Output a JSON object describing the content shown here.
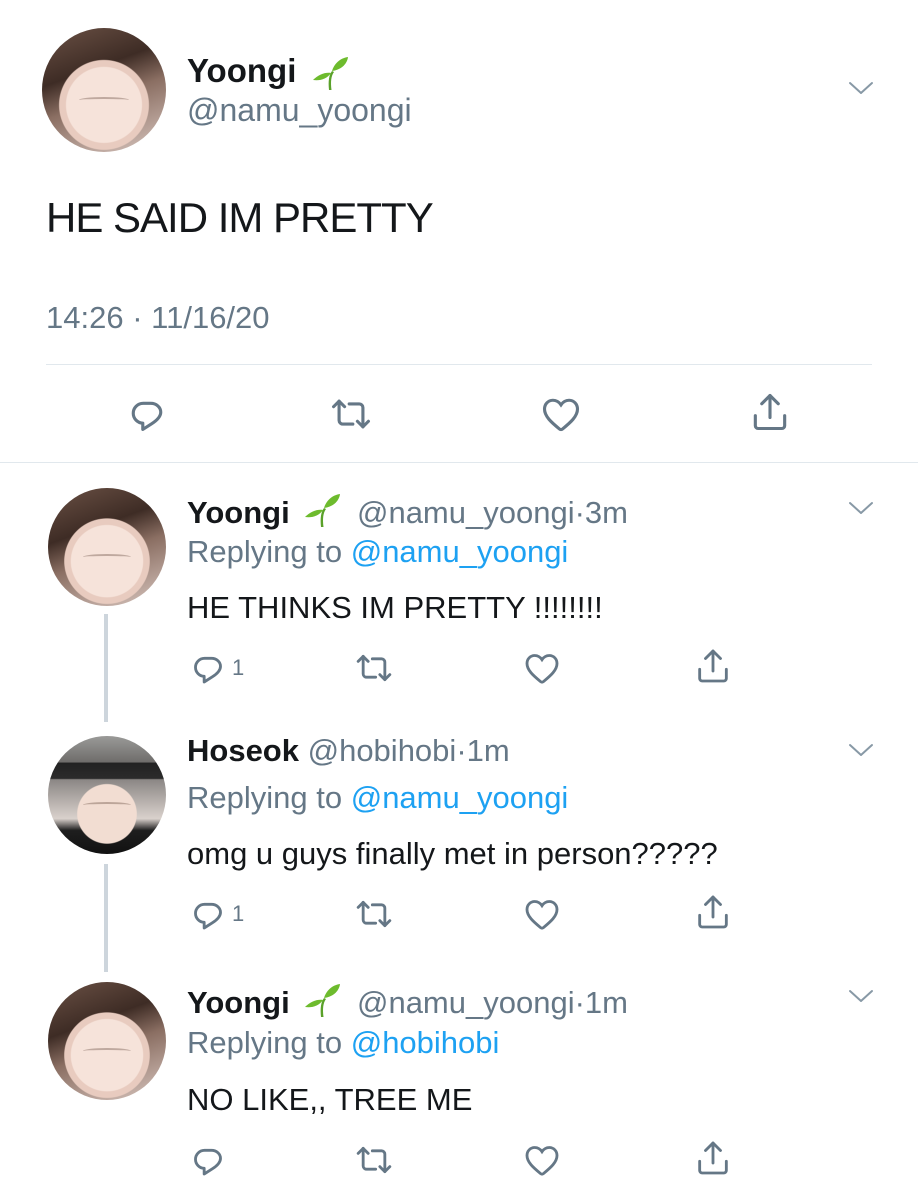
{
  "main_tweet": {
    "name": "Yoongi",
    "handle": "@namu_yoongi",
    "text": "HE SAID IM PRETTY",
    "time": "14:26",
    "date": "11/16/20"
  },
  "replies": [
    {
      "name": "Yoongi",
      "handle": "@namu_yoongi",
      "age": "3m",
      "replying_label": "Replying to",
      "replying_to": "@namu_yoongi",
      "text": "HE THINKS IM PRETTY !!!!!!!!",
      "reply_count": "1"
    },
    {
      "name": "Hoseok",
      "handle": "@hobihobi",
      "age": "1m",
      "replying_label": "Replying to",
      "replying_to": "@namu_yoongi",
      "text": "omg u guys finally met in person?????",
      "reply_count": "1"
    },
    {
      "name": "Yoongi",
      "handle": "@namu_yoongi",
      "age": "1m",
      "replying_label": "Replying to",
      "replying_to": "@hobihobi",
      "text": "NO LIKE,, TREE ME",
      "reply_count": ""
    }
  ],
  "separator": "·",
  "colors": {
    "link": "#1da1f2",
    "secondary_text": "#657786",
    "primary_text": "#14171a",
    "divider": "#e1e8ed",
    "seedling": "#6dbb2d"
  },
  "icons": [
    "seedling-icon",
    "chevron-down-icon",
    "reply-icon",
    "retweet-icon",
    "like-icon",
    "share-icon"
  ]
}
